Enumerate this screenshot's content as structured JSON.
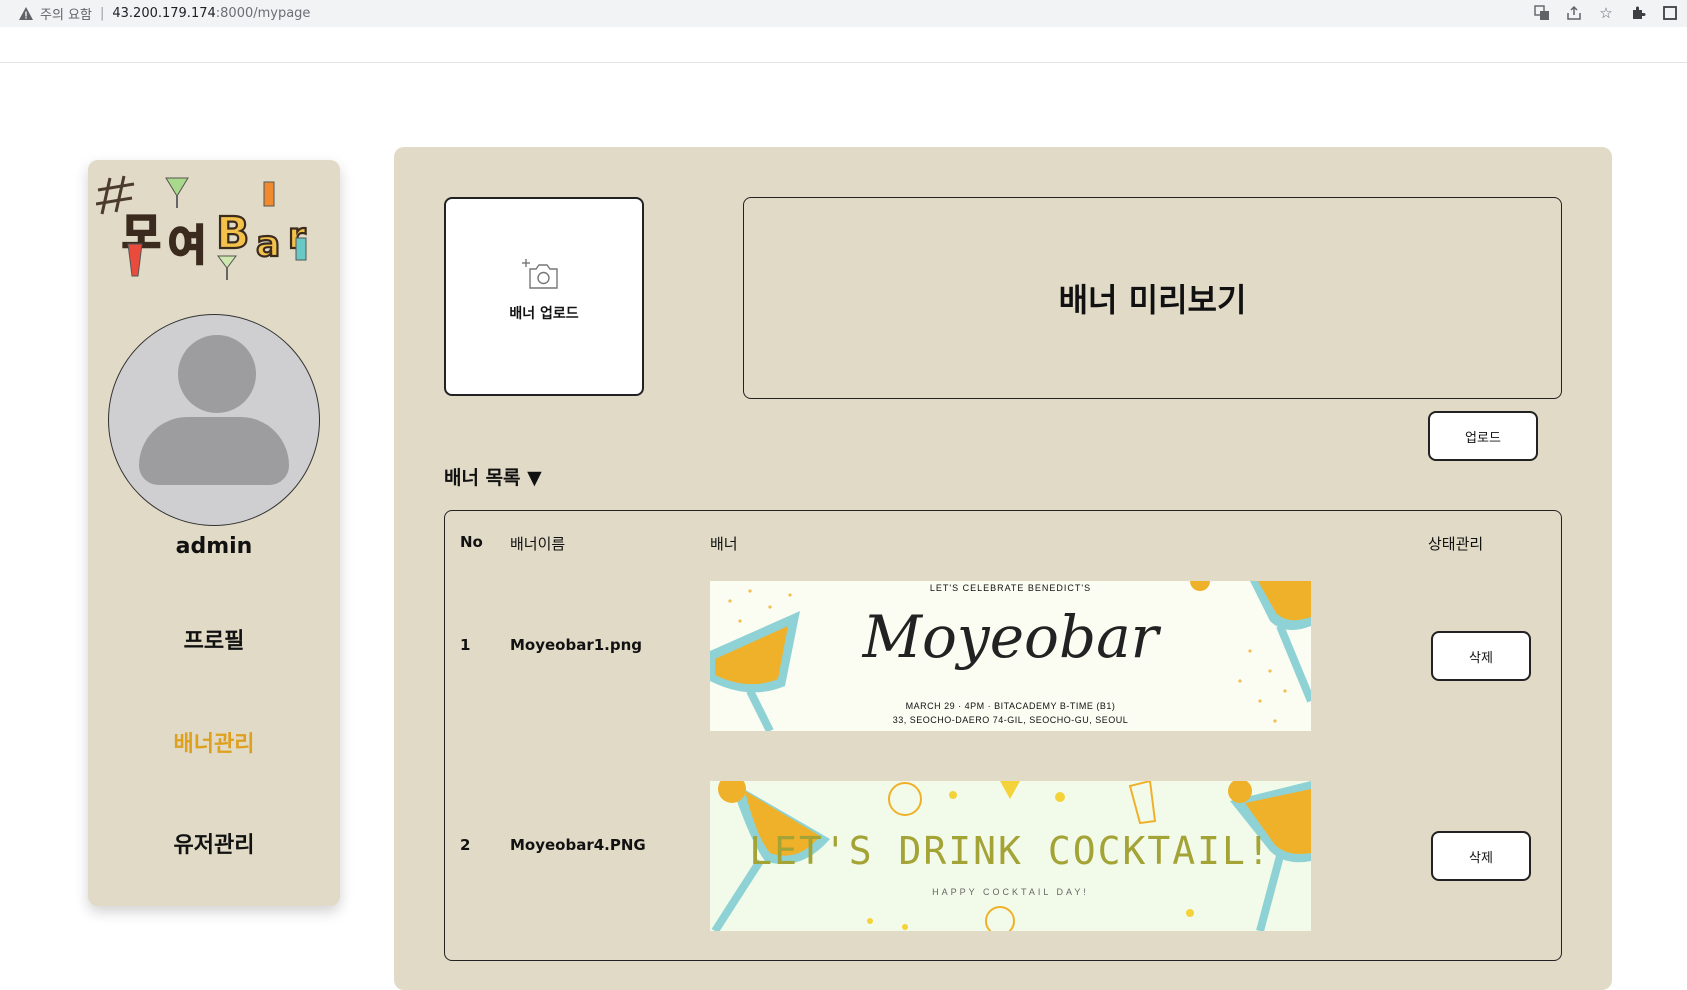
{
  "browser": {
    "warning_text": "주의 요함",
    "url_host": "43.200.179.174",
    "url_path": ":8000/mypage",
    "icons": [
      "translate-icon",
      "share-icon",
      "star-icon",
      "extension-icon",
      "window-icon"
    ]
  },
  "sidebar": {
    "logo_text": "#모여Bar",
    "username": "admin",
    "nav": [
      {
        "label": "프로필",
        "active": false
      },
      {
        "label": "배너관리",
        "active": true
      },
      {
        "label": "유저관리",
        "active": false
      }
    ],
    "active_color": "#dfa01e"
  },
  "main": {
    "upload_label": "배너 업로드",
    "preview_label": "배너 미리보기",
    "upload_button": "업로드",
    "list_title": "배너 목록 ▼",
    "table": {
      "headers": [
        "No",
        "배너이름",
        "배너",
        "상태관리"
      ],
      "rows": [
        {
          "no": "1",
          "name": "Moyeobar1.png",
          "action": "삭제",
          "banner": {
            "top": "LET'S CELEBRATE BENEDICT'S",
            "title": "Moyeobar",
            "line1": "MARCH 29 · 4PM · BITACADEMY B-TIME (B1)",
            "line2": "33, SEOCHO-DAERO 74-GIL, SEOCHO-GU, SEOUL"
          }
        },
        {
          "no": "2",
          "name": "Moyeobar4.PNG",
          "action": "삭제",
          "banner": {
            "title": "LET'S DRINK COCKTAIL!",
            "sub": "HAPPY COCKTAIL DAY!"
          }
        }
      ]
    }
  },
  "colors": {
    "panel_bg": "#e0dac6",
    "banner1_bg": "#fbfcf2",
    "banner2_bg": "#f2fbe9",
    "glass": "#8ed2d6",
    "orange": "#f0b12a"
  }
}
